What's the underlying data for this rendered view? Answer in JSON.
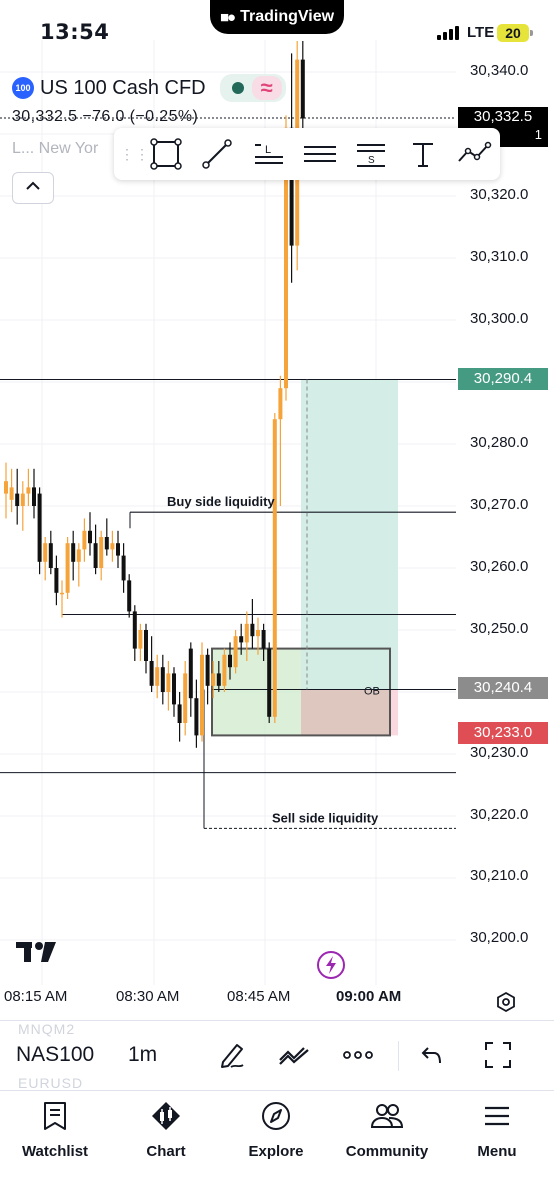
{
  "status_bar": {
    "time": "13:54",
    "island_label": "TradingView",
    "network": "LTE",
    "battery": "20"
  },
  "legend": {
    "symbol_badge": "100",
    "symbol_name": "US 100 Cash CFD",
    "price_line": "30,332.5  −76.0 (−0.25%)",
    "session_line": "L...  New Yor"
  },
  "price_axis": {
    "labels": [
      "30,340.0",
      "30,320.0",
      "30,310.0",
      "30,300.0",
      "30,280.0",
      "30,270.0",
      "30,260.0",
      "30,250.0",
      "30,230.0",
      "30,220.0",
      "30,210.0",
      "30,200.0"
    ],
    "last_price": "30,332.5",
    "last_price_sub": "1",
    "target_tag": "30,290.4",
    "entry_tag": "30,240.4",
    "stop_tag": "30,233.0"
  },
  "annotations": {
    "buy_side": "Buy side liquidity",
    "sell_side": "Sell side liquidity",
    "order_block": "OB"
  },
  "time_axis": [
    "08:15 AM",
    "08:30 AM",
    "08:45 AM",
    "09:00 AM"
  ],
  "symbol_bar": {
    "ghost_top": "MNQM2",
    "symbol": "NAS100",
    "interval": "1m",
    "ghost_bottom": "EURUSD"
  },
  "tabs": [
    {
      "label": "Watchlist",
      "icon": "watchlist-icon"
    },
    {
      "label": "Chart",
      "icon": "chart-icon"
    },
    {
      "label": "Explore",
      "icon": "compass-icon"
    },
    {
      "label": "Community",
      "icon": "community-icon"
    },
    {
      "label": "Menu",
      "icon": "menu-icon"
    }
  ],
  "colors": {
    "up": "#f5a33b",
    "down": "#111111",
    "target_zone": "#d3ece6",
    "stop_zone": "#f8d5dc",
    "target_tag": "#459b82",
    "entry_tag": "#8c8c8c",
    "stop_tag": "#e04e55"
  },
  "chart_data": {
    "type": "candlestick",
    "x": [
      "08:15 AM",
      "08:30 AM",
      "08:45 AM",
      "09:00 AM"
    ],
    "ylim": [
      30195,
      30345
    ],
    "y_ticks": [
      30200,
      30210,
      30220,
      30230,
      30250,
      30260,
      30270,
      30280,
      30300,
      30310,
      30320,
      30340
    ],
    "levels": {
      "buy_side_liquidity": 30269,
      "sell_side_liquidity": 30218,
      "target": 30290.4,
      "entry": 30240.4,
      "stop": 30233.0,
      "order_block_top": 30247,
      "order_block_bottom": 30233,
      "level_1": 30252.5,
      "level_2": 30227
    },
    "candles": [
      {
        "t": 0,
        "o": 30272,
        "h": 30277,
        "l": 30268,
        "c": 30274
      },
      {
        "t": 1,
        "o": 30271,
        "h": 30276,
        "l": 30269,
        "c": 30273
      },
      {
        "t": 2,
        "o": 30272,
        "h": 30276,
        "l": 30267,
        "c": 30270
      },
      {
        "t": 3,
        "o": 30270,
        "h": 30274,
        "l": 30266,
        "c": 30272
      },
      {
        "t": 4,
        "o": 30272,
        "h": 30276,
        "l": 30270,
        "c": 30273
      },
      {
        "t": 5,
        "o": 30273,
        "h": 30276,
        "l": 30268,
        "c": 30270
      },
      {
        "t": 6,
        "o": 30272,
        "h": 30273,
        "l": 30259,
        "c": 30261
      },
      {
        "t": 7,
        "o": 30261,
        "h": 30265,
        "l": 30258,
        "c": 30264
      },
      {
        "t": 8,
        "o": 30264,
        "h": 30266,
        "l": 30259,
        "c": 30260
      },
      {
        "t": 9,
        "o": 30260,
        "h": 30262,
        "l": 30254,
        "c": 30256
      },
      {
        "t": 10,
        "o": 30256,
        "h": 30258,
        "l": 30252,
        "c": 30256
      },
      {
        "t": 11,
        "o": 30256,
        "h": 30265,
        "l": 30255,
        "c": 30264
      },
      {
        "t": 12,
        "o": 30264,
        "h": 30266,
        "l": 30258,
        "c": 30261
      },
      {
        "t": 13,
        "o": 30261,
        "h": 30264,
        "l": 30257,
        "c": 30263
      },
      {
        "t": 14,
        "o": 30263,
        "h": 30268,
        "l": 30261,
        "c": 30266
      },
      {
        "t": 15,
        "o": 30266,
        "h": 30269,
        "l": 30262,
        "c": 30264
      },
      {
        "t": 16,
        "o": 30264,
        "h": 30267,
        "l": 30259,
        "c": 30260
      },
      {
        "t": 17,
        "o": 30260,
        "h": 30266,
        "l": 30258,
        "c": 30265
      },
      {
        "t": 18,
        "o": 30265,
        "h": 30268,
        "l": 30262,
        "c": 30263
      },
      {
        "t": 19,
        "o": 30263,
        "h": 30266,
        "l": 30261,
        "c": 30264
      },
      {
        "t": 20,
        "o": 30264,
        "h": 30266,
        "l": 30260,
        "c": 30262
      },
      {
        "t": 21,
        "o": 30262,
        "h": 30264,
        "l": 30256,
        "c": 30258
      },
      {
        "t": 22,
        "o": 30258,
        "h": 30259,
        "l": 30252,
        "c": 30253
      },
      {
        "t": 23,
        "o": 30253,
        "h": 30254,
        "l": 30245,
        "c": 30247
      },
      {
        "t": 24,
        "o": 30247,
        "h": 30251,
        "l": 30245,
        "c": 30250
      },
      {
        "t": 25,
        "o": 30250,
        "h": 30251,
        "l": 30243,
        "c": 30245
      },
      {
        "t": 26,
        "o": 30245,
        "h": 30249,
        "l": 30240,
        "c": 30241
      },
      {
        "t": 27,
        "o": 30241,
        "h": 30246,
        "l": 30239,
        "c": 30244
      },
      {
        "t": 28,
        "o": 30244,
        "h": 30246,
        "l": 30238,
        "c": 30240
      },
      {
        "t": 29,
        "o": 30240,
        "h": 30245,
        "l": 30237,
        "c": 30243
      },
      {
        "t": 30,
        "o": 30243,
        "h": 30244,
        "l": 30236,
        "c": 30238
      },
      {
        "t": 31,
        "o": 30238,
        "h": 30240,
        "l": 30232,
        "c": 30235
      },
      {
        "t": 32,
        "o": 30235,
        "h": 30245,
        "l": 30233,
        "c": 30243
      },
      {
        "t": 33,
        "o": 30247,
        "h": 30248,
        "l": 30236,
        "c": 30239
      },
      {
        "t": 34,
        "o": 30239,
        "h": 30242,
        "l": 30231,
        "c": 30233
      },
      {
        "t": 35,
        "o": 30233,
        "h": 30248,
        "l": 30232,
        "c": 30246
      },
      {
        "t": 36,
        "o": 30246,
        "h": 30247,
        "l": 30238,
        "c": 30241
      },
      {
        "t": 37,
        "o": 30241,
        "h": 30245,
        "l": 30239,
        "c": 30243
      },
      {
        "t": 38,
        "o": 30243,
        "h": 30245,
        "l": 30240,
        "c": 30241
      },
      {
        "t": 39,
        "o": 30241,
        "h": 30247,
        "l": 30240,
        "c": 30246
      },
      {
        "t": 40,
        "o": 30246,
        "h": 30248,
        "l": 30242,
        "c": 30244
      },
      {
        "t": 41,
        "o": 30244,
        "h": 30250,
        "l": 30243,
        "c": 30249
      },
      {
        "t": 42,
        "o": 30249,
        "h": 30251,
        "l": 30246,
        "c": 30248
      },
      {
        "t": 43,
        "o": 30248,
        "h": 30253,
        "l": 30245,
        "c": 30251
      },
      {
        "t": 44,
        "o": 30251,
        "h": 30255,
        "l": 30247,
        "c": 30249
      },
      {
        "t": 45,
        "o": 30249,
        "h": 30252,
        "l": 30246,
        "c": 30250
      },
      {
        "t": 46,
        "o": 30250,
        "h": 30251,
        "l": 30245,
        "c": 30247
      },
      {
        "t": 47,
        "o": 30247,
        "h": 30248,
        "l": 30235,
        "c": 30236
      },
      {
        "t": 48,
        "o": 30236,
        "h": 30285,
        "l": 30235,
        "c": 30284
      },
      {
        "t": 49,
        "o": 30284,
        "h": 30291,
        "l": 30270,
        "c": 30289
      },
      {
        "t": 50,
        "o": 30289,
        "h": 30333,
        "l": 30287,
        "c": 30331
      },
      {
        "t": 51,
        "o": 30331,
        "h": 30343,
        "l": 30306,
        "c": 30312
      },
      {
        "t": 52,
        "o": 30312,
        "h": 30345,
        "l": 30308,
        "c": 30342
      },
      {
        "t": 53,
        "o": 30342,
        "h": 30345,
        "l": 30326,
        "c": 30332.5
      }
    ]
  }
}
